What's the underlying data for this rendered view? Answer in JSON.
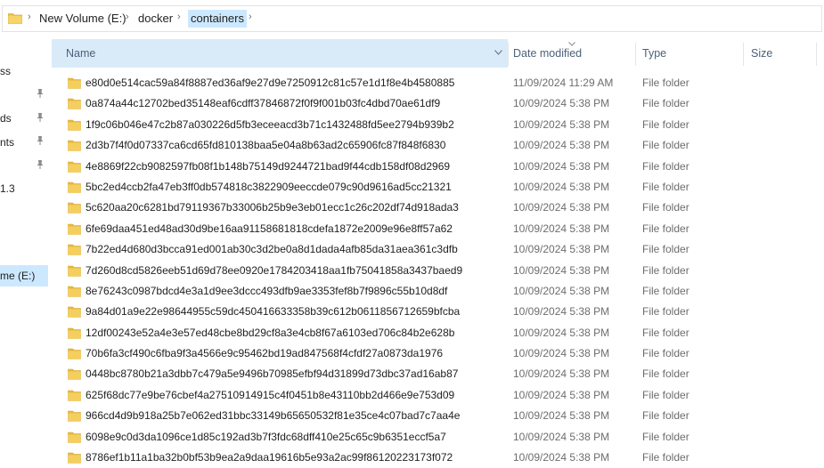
{
  "address_bar": {
    "crumbs": [
      "New Volume (E:)",
      "docker",
      "containers"
    ],
    "separator": ">"
  },
  "nav_pane": {
    "items": [
      "ss",
      "ds",
      "nts",
      "1.3",
      "me (E:)"
    ]
  },
  "columns": {
    "name": "Name",
    "date_modified": "Date modified",
    "type": "Type",
    "size": "Size"
  },
  "files": [
    {
      "name": "e80d0e514cac59a84f8887ed36af9e27d9e7250912c81c57e1d1f8e4b4580885",
      "date": "11/09/2024 11:29 AM",
      "type": "File folder",
      "size": ""
    },
    {
      "name": "0a874a44c12702bed35148eaf6cdff37846872f0f9f001b03fc4dbd70ae61df9",
      "date": "10/09/2024 5:38 PM",
      "type": "File folder",
      "size": ""
    },
    {
      "name": "1f9c06b046e47c2b87a030226d5fb3eceeacd3b71c1432488fd5ee2794b939b2",
      "date": "10/09/2024 5:38 PM",
      "type": "File folder",
      "size": ""
    },
    {
      "name": "2d3b7f4f0d07337ca6cd65fd810138baa5e04a8b63ad2c65906fc87f848f6830",
      "date": "10/09/2024 5:38 PM",
      "type": "File folder",
      "size": ""
    },
    {
      "name": "4e8869f22cb9082597fb08f1b148b75149d9244721bad9f44cdb158df08d2969",
      "date": "10/09/2024 5:38 PM",
      "type": "File folder",
      "size": ""
    },
    {
      "name": "5bc2ed4ccb2fa47eb3ff0db574818c3822909eeccde079c90d9616ad5cc21321",
      "date": "10/09/2024 5:38 PM",
      "type": "File folder",
      "size": ""
    },
    {
      "name": "5c620aa20c6281bd79119367b33006b25b9e3eb01ecc1c26c202df74d918ada3",
      "date": "10/09/2024 5:38 PM",
      "type": "File folder",
      "size": ""
    },
    {
      "name": "6fe69daa451ed48ad30d9be16aa91158681818cdefa1872e2009e96e8ff57a62",
      "date": "10/09/2024 5:38 PM",
      "type": "File folder",
      "size": ""
    },
    {
      "name": "7b22ed4d680d3bcca91ed001ab30c3d2be0a8d1dada4afb85da31aea361c3dfb",
      "date": "10/09/2024 5:38 PM",
      "type": "File folder",
      "size": ""
    },
    {
      "name": "7d260d8cd5826eeb51d69d78ee0920e1784203418aa1fb75041858a3437baed9",
      "date": "10/09/2024 5:38 PM",
      "type": "File folder",
      "size": ""
    },
    {
      "name": "8e76243c0987bdcd4e3a1d9ee3dccc493dfb9ae3353fef8b7f9896c55b10d8df",
      "date": "10/09/2024 5:38 PM",
      "type": "File folder",
      "size": ""
    },
    {
      "name": "9a84d01a9e22e98644955c59dc450416633358b39c612b0611856712659bfcba",
      "date": "10/09/2024 5:38 PM",
      "type": "File folder",
      "size": ""
    },
    {
      "name": "12df00243e52a4e3e57ed48cbe8bd29cf8a3e4cb8f67a6103ed706c84b2e628b",
      "date": "10/09/2024 5:38 PM",
      "type": "File folder",
      "size": ""
    },
    {
      "name": "70b6fa3cf490c6fba9f3a4566e9c95462bd19ad847568f4cfdf27a0873da1976",
      "date": "10/09/2024 5:38 PM",
      "type": "File folder",
      "size": ""
    },
    {
      "name": "0448bc8780b21a3dbb7c479a5e9496b70985efbf94d31899d73dbc37ad16ab87",
      "date": "10/09/2024 5:38 PM",
      "type": "File folder",
      "size": ""
    },
    {
      "name": "625f68dc77e9be76cbef4a27510914915c4f0451b8e43110bb2d466e9e753d09",
      "date": "10/09/2024 5:38 PM",
      "type": "File folder",
      "size": ""
    },
    {
      "name": "966cd4d9b918a25b7e062ed31bbc33149b65650532f81e35ce4c07bad7c7aa4e",
      "date": "10/09/2024 5:38 PM",
      "type": "File folder",
      "size": ""
    },
    {
      "name": "6098e9c0d3da1096ce1d85c192ad3b7f3fdc68dff410e25c65c9b6351eccf5a7",
      "date": "10/09/2024 5:38 PM",
      "type": "File folder",
      "size": ""
    },
    {
      "name": "8786ef1b11a1ba32b0bf53b9ea2a9daa19616b5e93a2ac99f86120223173f072",
      "date": "10/09/2024 5:38 PM",
      "type": "File folder",
      "size": ""
    }
  ],
  "colors": {
    "folder": "#f0c54d",
    "selection": "#cce8ff",
    "header_highlight": "#d9ebf9",
    "secondary_text": "#6d6d6d"
  },
  "icons": {
    "folder": "folder-icon",
    "pin": "pin-icon",
    "chevron": "chevron-right-icon",
    "sort": "sort-caret-icon",
    "dropdown": "column-dropdown-icon"
  }
}
